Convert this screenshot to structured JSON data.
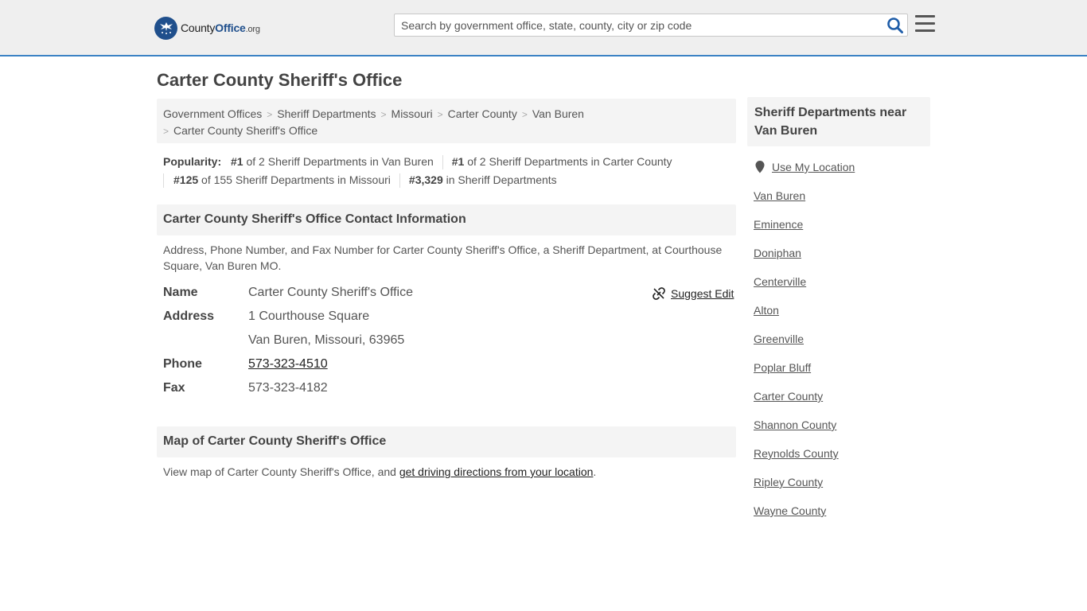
{
  "header": {
    "logo": {
      "prefix": "County",
      "brand": "Office",
      "suffix": ".org"
    },
    "search_placeholder": "Search by government office, state, county, city or zip code",
    "accent_color": "#3b82c4",
    "brand_color": "#1f4f8c",
    "icons": {
      "search": "search-icon",
      "menu": "hamburger-menu-icon"
    }
  },
  "page": {
    "title": "Carter County Sheriff's Office"
  },
  "breadcrumbs": [
    "Government Offices",
    "Sheriff Departments",
    "Missouri",
    "Carter County",
    "Van Buren",
    "Carter County Sheriff's Office"
  ],
  "popularity": {
    "label": "Popularity:",
    "items": [
      {
        "rank": "#1",
        "text": " of 2 Sheriff Departments in Van Buren"
      },
      {
        "rank": "#1",
        "text": " of 2 Sheriff Departments in Carter County"
      },
      {
        "rank": "#125",
        "text": " of 155 Sheriff Departments in Missouri"
      },
      {
        "rank": "#3,329",
        "text": " in Sheriff Departments"
      }
    ]
  },
  "contact": {
    "heading": "Carter County Sheriff's Office Contact Information",
    "description": "Address, Phone Number, and Fax Number for Carter County Sheriff's Office, a Sheriff Department, at Courthouse Square, Van Buren MO.",
    "suggest_edit": "Suggest Edit",
    "fields": {
      "name_label": "Name",
      "name_value": "Carter County Sheriff's Office",
      "address_label": "Address",
      "address_line1": "1 Courthouse Square",
      "address_line2": "Van Buren, Missouri, 63965",
      "phone_label": "Phone",
      "phone_value": "573-323-4510",
      "fax_label": "Fax",
      "fax_value": "573-323-4182"
    }
  },
  "map": {
    "heading": "Map of Carter County Sheriff's Office",
    "text_before": "View map of Carter County Sheriff's Office, and ",
    "link_text": "get driving directions from your location",
    "text_after": "."
  },
  "sidebar": {
    "heading": "Sheriff Departments near Van Buren",
    "use_location": "Use My Location",
    "links": [
      "Van Buren",
      "Eminence",
      "Doniphan",
      "Centerville",
      "Alton",
      "Greenville",
      "Poplar Bluff",
      "Carter County",
      "Shannon County",
      "Reynolds County",
      "Ripley County",
      "Wayne County"
    ]
  }
}
